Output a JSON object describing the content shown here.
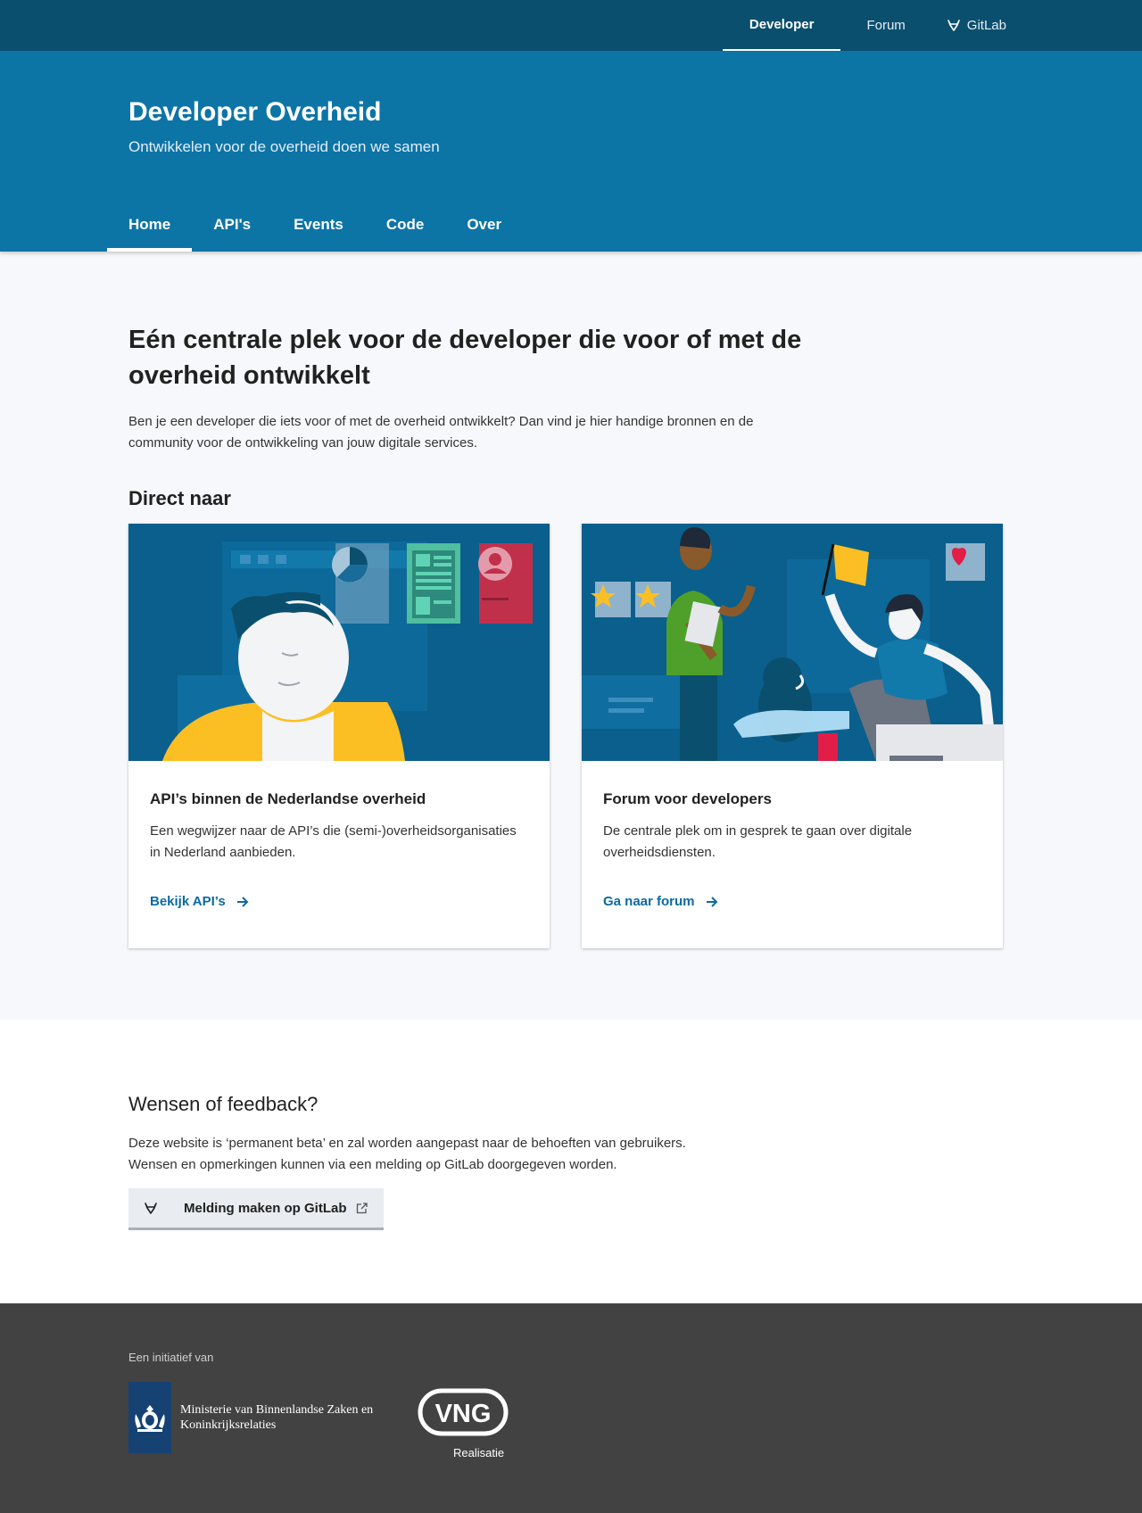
{
  "topnav": {
    "developer": "Developer",
    "forum": "Forum",
    "gitlab": "GitLab"
  },
  "header": {
    "title": "Developer Overheid",
    "subtitle": "Ontwikkelen voor de overheid doen we samen"
  },
  "mainnav": [
    "Home",
    "API's",
    "Events",
    "Code",
    "Over"
  ],
  "hero": {
    "title": "Eén centrale plek voor de developer die voor of met de overheid ontwikkelt",
    "intro": "Ben je een developer die iets voor of met de overheid ontwikkelt? Dan vind je hier handige bronnen en de community voor de ontwikkeling van jouw digitale services."
  },
  "direct": {
    "heading": "Direct naar",
    "cards": [
      {
        "title": "API’s binnen de Nederlandse overheid",
        "text": "Een wegwijzer naar de API’s die (semi-)overheidsorganisaties in Nederland aanbieden.",
        "link": "Bekijk API’s"
      },
      {
        "title": "Forum voor developers",
        "text": "De centrale plek om in gesprek te gaan over digitale overheidsdiensten.",
        "link": "Ga naar forum"
      }
    ]
  },
  "feedback": {
    "heading": "Wensen of feedback?",
    "line1": "Deze website is ‘permanent beta’ en zal worden aangepast naar de behoeften van gebruikers.",
    "line2": "Wensen en opmerkingen kunnen via een melding op GitLab doorgegeven worden.",
    "button": "Melding maken op GitLab"
  },
  "footer": {
    "initiative": "Een initiatief van",
    "ministry_line1": "Ministerie van Binnenlandse Zaken en",
    "ministry_line2": "Koninkrijksrelaties",
    "vng_logo_text": "VNG",
    "vng_sub": "Realisatie"
  },
  "colors": {
    "topbar": "#0b4f6e",
    "header": "#0d74a6",
    "link": "#0d6aa0",
    "footer": "#424242"
  }
}
